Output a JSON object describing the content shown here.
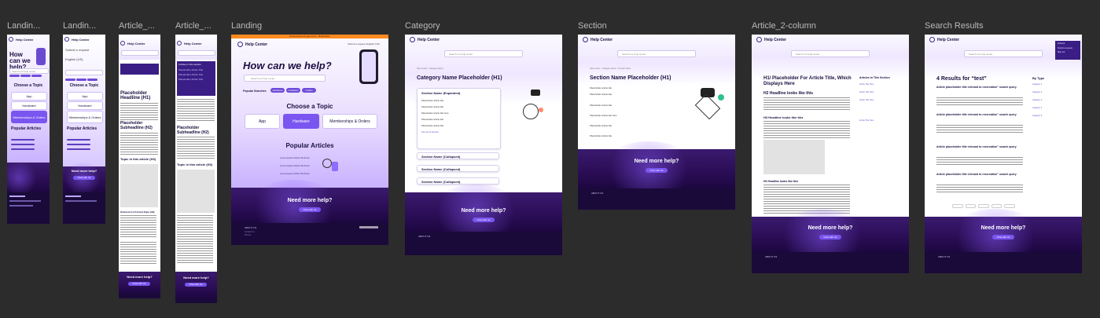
{
  "labels": [
    "Landin...",
    "Landin...",
    "Article_...",
    "Article_...",
    "Landing",
    "Category",
    "Section",
    "Article_2-column",
    "Search Results"
  ],
  "brand": "Help Center",
  "lang": "English (US)",
  "nav_submit": "Submit a request",
  "nav_signin": "Sign in",
  "search_placeholder": "Search our help center",
  "banner": "Announcement goes here · Read More",
  "landing": {
    "hero_title": "How can we help?",
    "popular_searches": "Popular Searches",
    "pills": [
      "Hardware",
      "Locations",
      "Orders"
    ],
    "choose_topic": "Choose a Topic",
    "topics": [
      "App",
      "Hardware",
      "Memberships & Orders"
    ],
    "popular_articles": "Popular Articles",
    "articles": [
      "Lorem Ipsum Dolor Sit Amet",
      "Lorem Ipsum Dolor Sit Amet",
      "Lorem Ipsum Dolor Sit Amet"
    ],
    "need_help": "Need more help?",
    "chat_btn": "Chat with Us"
  },
  "mobile": {
    "hero_title": "How can we help?",
    "choose_topic": "Choose a Topic",
    "topics": [
      "App",
      "Hardware",
      "Memberships & Orders"
    ],
    "popular": "Popular Articles",
    "need_help": "Need more help?",
    "chat_btn": "Chat with Us"
  },
  "mobile_article": {
    "headline": "Placeholder Headline (H1)",
    "subheadline": "Placeholder Subheadline (H2)",
    "toc": "Topic in this article (H3)",
    "need_help": "Need more help?",
    "chat_btn": "Chat with Us",
    "list_title": "Ordered List Format Style (H3)",
    "menu_items": [
      "Articles in this section",
      "Placeholder Article Title",
      "Placeholder Article Title",
      "Placeholder Article Title"
    ]
  },
  "category": {
    "crumb": "Help Center > Category Name",
    "title": "Category Name Placeholder (H1)",
    "expanded": "Section Name (Expanded)",
    "items": [
      "Placeholder article title",
      "Placeholder article title",
      "Placeholder article title here",
      "Placeholder article title",
      "Placeholder article title"
    ],
    "see_all": "See all 11 articles",
    "collapsed": [
      "Section Name (Collapsed)",
      "Section Name (Collapsed)",
      "Section Name (Collapsed)"
    ],
    "need_help": "Need more help?",
    "chat_btn": "Chat with Us"
  },
  "section": {
    "crumb": "Help Center > Category Name > Section Name",
    "title": "Section Name Placeholder (H1)",
    "items": [
      "Placeholder article title",
      "Placeholder article title",
      "Placeholder article title",
      "Placeholder article title here",
      "Placeholder article title",
      "Placeholder article title"
    ],
    "need_help": "Need more help?",
    "chat_btn": "Chat with Us"
  },
  "article2": {
    "title": "H1/ Placeholder For Article Title, Which Displays Here",
    "h2": "H2 Headline looks like this",
    "h3": "H3 Headline looks like this",
    "h4": "H4 Headline looks like this",
    "side_title": "Articles in This Section",
    "side_items": [
      "Article Title Here",
      "Article Title Here",
      "Article Title Here",
      "Article Title Here"
    ],
    "need_help": "Need more help?",
    "chat_btn": "Chat with Us"
  },
  "search": {
    "title": "4 Results for “test”",
    "result_title": "Article placeholder title relevant to reservation” search query",
    "by_type": "By Type",
    "types": [
      "Category 1",
      "Category 2",
      "Category 3",
      "Category 4",
      "Category 5"
    ],
    "need_help": "Need more help?",
    "chat_btn": "Chat with Us",
    "menu": [
      "Account",
      "Submit a request",
      "Sign out"
    ]
  },
  "footer": {
    "about": "ABOUT US",
    "links": [
      "Contact Us",
      "Privacy",
      "Terms of Use"
    ]
  },
  "colors": {
    "accent": "#7a55f0",
    "dark": "#2a0d55",
    "canvas": "#2c2c2c"
  }
}
